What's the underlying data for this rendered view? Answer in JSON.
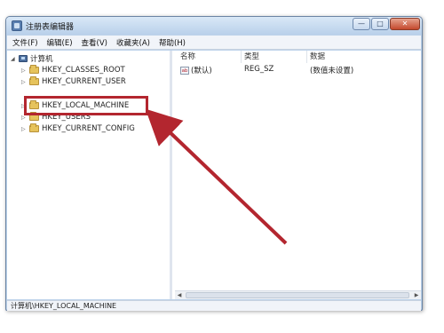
{
  "window": {
    "title": "注册表编辑器"
  },
  "caption_buttons": {
    "minimize": "—",
    "maximize": "□",
    "close": "✕"
  },
  "menu": [
    "文件(F)",
    "编辑(E)",
    "查看(V)",
    "收藏夹(A)",
    "帮助(H)"
  ],
  "tree": {
    "root": "计算机",
    "items": [
      "HKEY_CLASSES_ROOT",
      "HKEY_CURRENT_USER",
      "HKEY_LOCAL_MACHINE",
      "HKEY_USERS",
      "HKEY_CURRENT_CONFIG"
    ]
  },
  "values_table": {
    "columns": [
      "名称",
      "类型",
      "数据"
    ],
    "rows": [
      {
        "icon": "ab",
        "name": "(默认)",
        "type": "REG_SZ",
        "data": "(数值未设置)"
      }
    ]
  },
  "statusbar": {
    "path": "计算机\\HKEY_LOCAL_MACHINE"
  },
  "colors": {
    "highlight": "#b3262f",
    "arrow": "#b3262f"
  },
  "icons": {
    "app": "registry-editor-icon",
    "root": "computer-icon",
    "key": "folder-icon"
  }
}
